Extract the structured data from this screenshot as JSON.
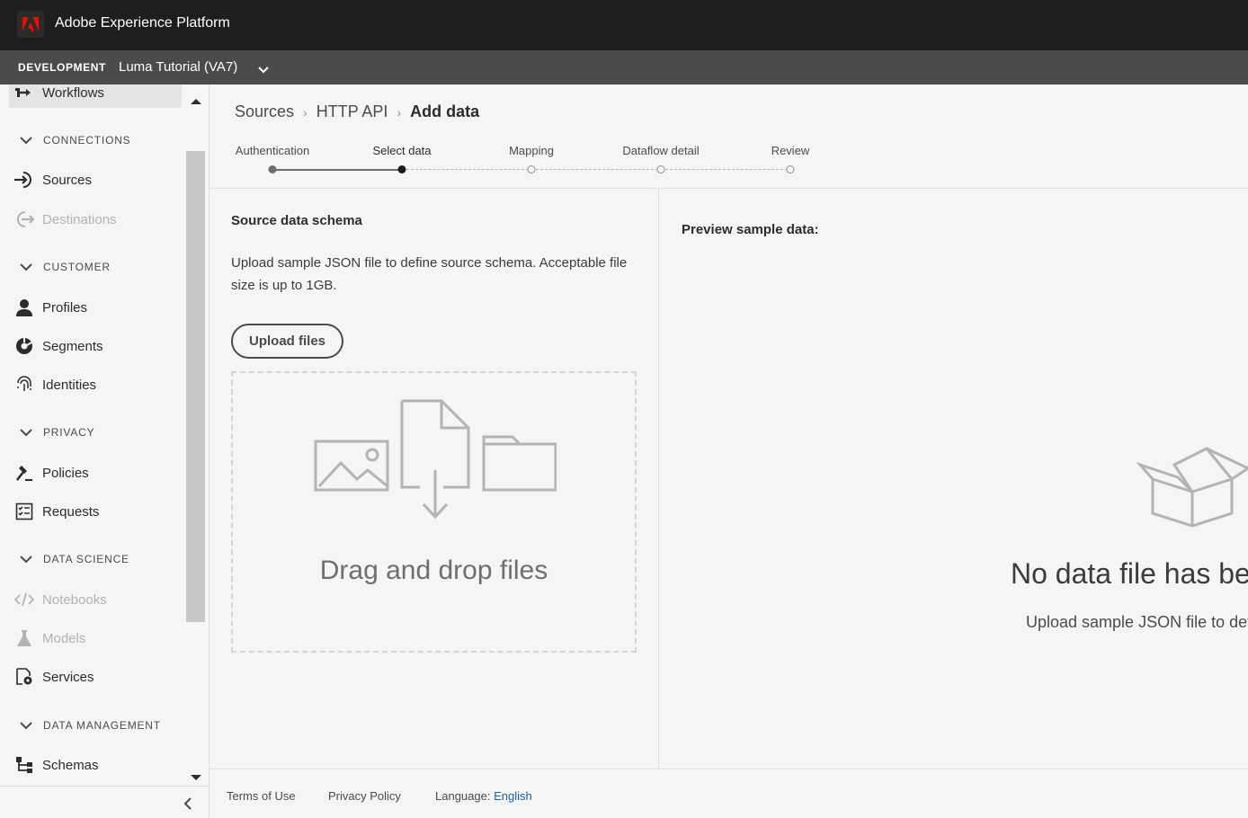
{
  "header": {
    "app_title": "Adobe Experience Platform",
    "logo_icon": "adobe-logo-icon",
    "brand_color": "#eb1000"
  },
  "sandbox": {
    "environment": "DEVELOPMENT",
    "name": "Luma Tutorial (VA7)"
  },
  "sidebar": {
    "workflows": "Workflows",
    "sections": {
      "connections": "CONNECTIONS",
      "customer": "CUSTOMER",
      "privacy": "PRIVACY",
      "data_science": "DATA SCIENCE",
      "data_management": "DATA MANAGEMENT"
    },
    "items": {
      "sources": "Sources",
      "destinations": "Destinations",
      "profiles": "Profiles",
      "segments": "Segments",
      "identities": "Identities",
      "policies": "Policies",
      "requests": "Requests",
      "notebooks": "Notebooks",
      "models": "Models",
      "services": "Services",
      "schemas": "Schemas"
    }
  },
  "breadcrumb": {
    "items": [
      "Sources",
      "HTTP API",
      "Add data"
    ]
  },
  "steps": {
    "labels": [
      "Authentication",
      "Select data",
      "Mapping",
      "Dataflow detail",
      "Review"
    ],
    "current_index": 1
  },
  "schema_panel": {
    "title": "Source data schema",
    "description": "Upload sample JSON file to define source schema. Acceptable file size is up to 1GB.",
    "upload_button": "Upload files",
    "drop_text": "Drag and drop files"
  },
  "preview_panel": {
    "title": "Preview sample data:",
    "empty_title": "No data file has been",
    "empty_subtitle": "Upload sample JSON file to define"
  },
  "footer": {
    "terms": "Terms of Use",
    "privacy": "Privacy Policy",
    "language_label": "Language:",
    "language_value": "English"
  }
}
